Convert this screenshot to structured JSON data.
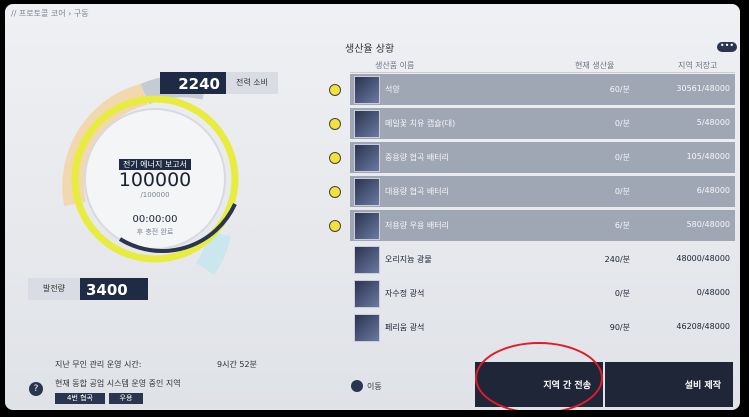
{
  "breadcrumb": "// 프로토콜 코어 › 구동",
  "power": {
    "consumption_value": "2240",
    "consumption_label": "전력 소비",
    "report_label": "전기 에너지 보고서",
    "stored": "100000",
    "capacity": "/100000",
    "timer": "00:00:00",
    "timer_caption": "후 충전 완료",
    "generation_label": "발전량",
    "generation_value": "3400"
  },
  "production": {
    "title": "생산율 상황",
    "more": "•••",
    "columns": {
      "name": "생산품 이름",
      "rate": "현재 생산율",
      "stock": "지역 저장고"
    },
    "rows": [
      {
        "name": "석양",
        "rate": "60/분",
        "stock": "30561/48000",
        "selected": true,
        "starred": true
      },
      {
        "name": "메일꽃 치유 캡슐(대)",
        "rate": "0/분",
        "stock": "5/48000",
        "selected": true,
        "starred": true
      },
      {
        "name": "중용량 협곡 배터리",
        "rate": "0/분",
        "stock": "105/48000",
        "selected": true,
        "starred": true
      },
      {
        "name": "대용량 협곡 배터리",
        "rate": "0/분",
        "stock": "6/48000",
        "selected": true,
        "starred": true
      },
      {
        "name": "저용량 우용 배터리",
        "rate": "6/분",
        "stock": "580/48000",
        "selected": true,
        "starred": true
      },
      {
        "name": "오리지늄 광물",
        "rate": "240/분",
        "stock": "48000/48000",
        "selected": false,
        "starred": false
      },
      {
        "name": "자수정 광석",
        "rate": "0/분",
        "stock": "0/48000",
        "selected": false,
        "starred": false
      },
      {
        "name": "페리움 광석",
        "rate": "90/분",
        "stock": "46208/48000",
        "selected": false,
        "starred": false
      }
    ]
  },
  "bottom": {
    "line1_label": "지난 무인 관리 운영 시간:",
    "line1_value": "9시간 52분",
    "line2": "현재 동합 공업 시스템 운영 중인 지역",
    "tag1": "4번 협곡",
    "tag2": "우용",
    "move_label": "이동",
    "transfer_button": "지역 간 전송",
    "build_button": "설비 제작",
    "help": "?"
  }
}
